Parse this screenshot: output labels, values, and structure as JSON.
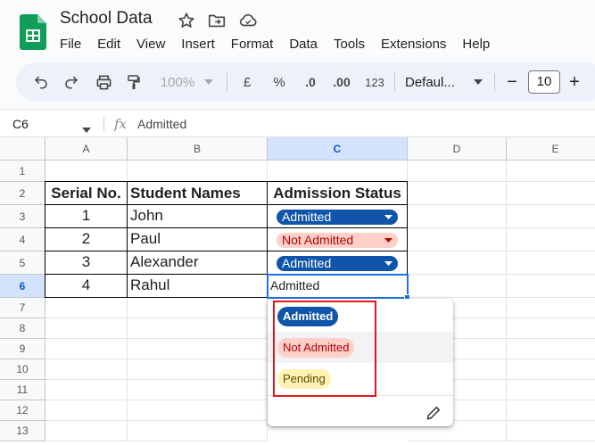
{
  "app": {
    "title": "School Data",
    "menu": [
      "File",
      "Edit",
      "View",
      "Insert",
      "Format",
      "Data",
      "Tools",
      "Extensions",
      "Help"
    ]
  },
  "toolbar": {
    "zoom": "100%",
    "currency": "£",
    "percent": "%",
    "decrease_decimal": ".0",
    "increase_decimal": ".00",
    "number_format": "123",
    "font": "Defaul...",
    "font_size": "10",
    "minus": "−",
    "plus": "+"
  },
  "formula_bar": {
    "cell_ref": "C6",
    "fx": "fx",
    "value": "Admitted"
  },
  "columns": [
    "A",
    "B",
    "C",
    "D",
    "E"
  ],
  "rows": [
    "1",
    "2",
    "3",
    "4",
    "5",
    "6",
    "7",
    "8",
    "9",
    "10",
    "11",
    "12",
    "13"
  ],
  "table": {
    "headers": [
      "Serial No.",
      "Student Names",
      "Admission Status"
    ],
    "rows": [
      {
        "serial": "1",
        "name": "John",
        "status": "Admitted"
      },
      {
        "serial": "2",
        "name": "Paul",
        "status": "Not Admitted"
      },
      {
        "serial": "3",
        "name": "Alexander",
        "status": "Admitted"
      },
      {
        "serial": "4",
        "name": "Rahul",
        "status": "Admitted"
      }
    ]
  },
  "dropdown": {
    "options": [
      "Admitted",
      "Not Admitted",
      "Pending"
    ]
  },
  "colors": {
    "admitted_chip": "#1155aa",
    "not_admitted_chip": "#ffcfc9",
    "pending_chip": "#fff2b3",
    "selection": "#1a73e8",
    "highlight_box": "#e0161b"
  },
  "icons": [
    "sheets-logo-icon",
    "star-icon",
    "move-folder-icon",
    "cloud-status-icon",
    "undo-icon",
    "redo-icon",
    "print-icon",
    "paint-format-icon",
    "dropdown-arrow-icon",
    "edit-pencil-icon"
  ]
}
